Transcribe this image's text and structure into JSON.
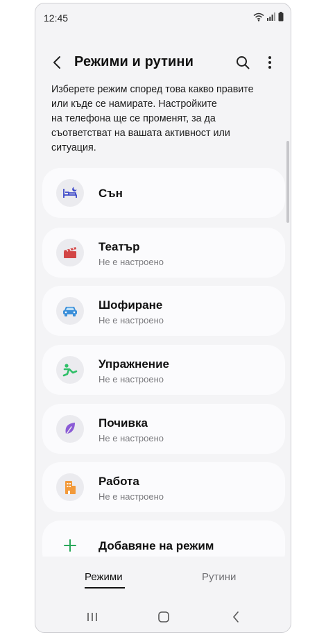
{
  "status_bar": {
    "time": "12:45"
  },
  "header": {
    "title": "Режими и рутини"
  },
  "description_lines": [
    "Изберете режим според това какво правите",
    "или къде се намирате. Настройките",
    "на телефона ще се променят, за да",
    "съответстват на вашата активност или",
    "ситуация."
  ],
  "modes": [
    {
      "name": "Сън",
      "status": "",
      "icon": "sleep-icon",
      "color": "#3d49c9"
    },
    {
      "name": "Театър",
      "status": "Не е настроено",
      "icon": "theater-icon",
      "color": "#d24545"
    },
    {
      "name": "Шофиране",
      "status": "Не е настроено",
      "icon": "car-icon",
      "color": "#3b8fd9"
    },
    {
      "name": "Упражнение",
      "status": "Не е настроено",
      "icon": "exercise-icon",
      "color": "#2fbf68"
    },
    {
      "name": "Почивка",
      "status": "Не е настроено",
      "icon": "leaf-icon",
      "color": "#8b5bd6"
    },
    {
      "name": "Работа",
      "status": "Не е настроено",
      "icon": "building-icon",
      "color": "#f29a3b"
    }
  ],
  "add_mode": {
    "label": "Добавяне на режим",
    "icon": "plus-icon",
    "color": "#2aa85a"
  },
  "tabs": {
    "modes": "Режими",
    "routines": "Рутини"
  }
}
